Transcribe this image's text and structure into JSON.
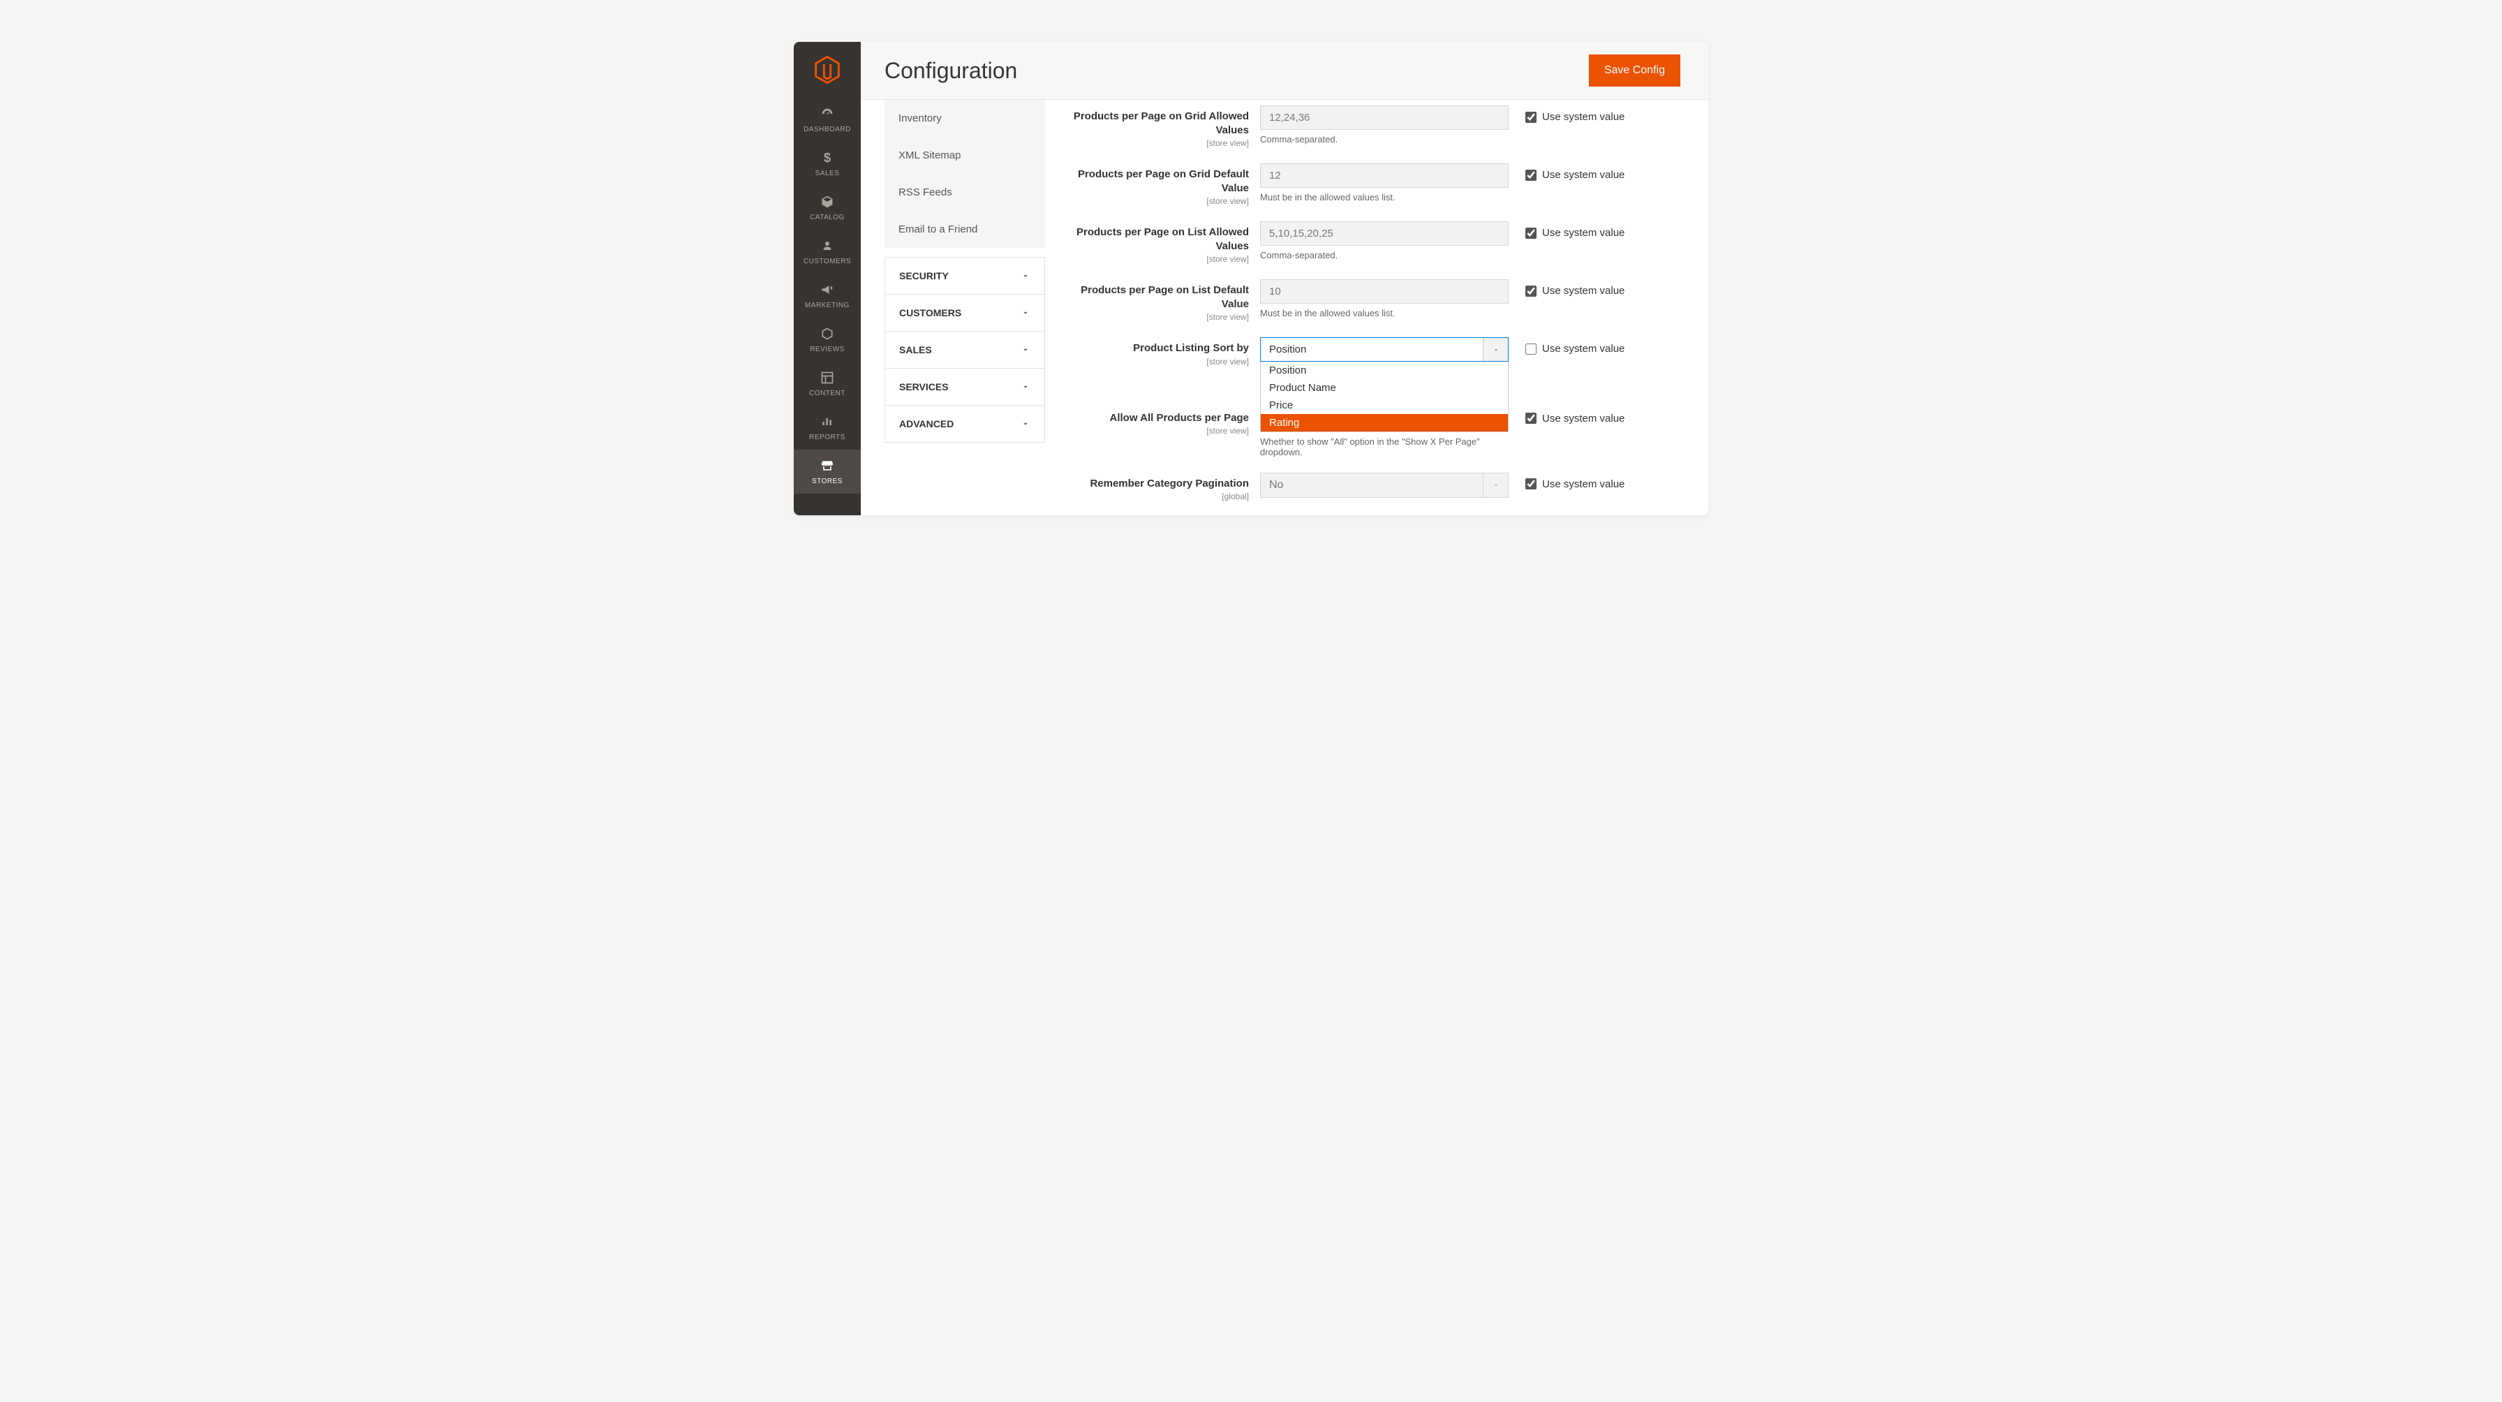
{
  "header": {
    "title": "Configuration",
    "save_button": "Save Config"
  },
  "nav": {
    "items": [
      {
        "label": "DASHBOARD"
      },
      {
        "label": "SALES"
      },
      {
        "label": "CATALOG"
      },
      {
        "label": "CUSTOMERS"
      },
      {
        "label": "MARKETING"
      },
      {
        "label": "REVIEWS"
      },
      {
        "label": "CONTENT"
      },
      {
        "label": "REPORTS"
      },
      {
        "label": "STORES"
      }
    ]
  },
  "config_nav": {
    "subitems": [
      "Inventory",
      "XML Sitemap",
      "RSS Feeds",
      "Email to a Friend"
    ],
    "sections": [
      "SECURITY",
      "CUSTOMERS",
      "SALES",
      "SERVICES",
      "ADVANCED"
    ]
  },
  "fields": {
    "grid_allowed": {
      "label": "Products per Page on Grid Allowed Values",
      "scope": "[store view]",
      "value": "12,24,36",
      "hint": "Comma-separated.",
      "use_system": "Use system value"
    },
    "grid_default": {
      "label": "Products per Page on Grid Default Value",
      "scope": "[store view]",
      "value": "12",
      "hint": "Must be in the allowed values list.",
      "use_system": "Use system value"
    },
    "list_allowed": {
      "label": "Products per Page on List Allowed Values",
      "scope": "[store view]",
      "value": "5,10,15,20,25",
      "hint": "Comma-separated.",
      "use_system": "Use system value"
    },
    "list_default": {
      "label": "Products per Page on List Default Value",
      "scope": "[store view]",
      "value": "10",
      "hint": "Must be in the allowed values list.",
      "use_system": "Use system value"
    },
    "sort_by": {
      "label": "Product Listing Sort by",
      "scope": "[store view]",
      "value": "Position",
      "options": [
        "Position",
        "Product Name",
        "Price",
        "Rating"
      ],
      "highlighted_option": "Rating",
      "use_system": "Use system value"
    },
    "allow_all": {
      "label": "Allow All Products per Page",
      "scope": "[store view]",
      "hint": "Whether to show \"All\" option in the \"Show X Per Page\" dropdown.",
      "use_system": "Use system value"
    },
    "remember_pag": {
      "label": "Remember Category Pagination",
      "scope": "[global]",
      "value": "No",
      "use_system": "Use system value"
    }
  }
}
